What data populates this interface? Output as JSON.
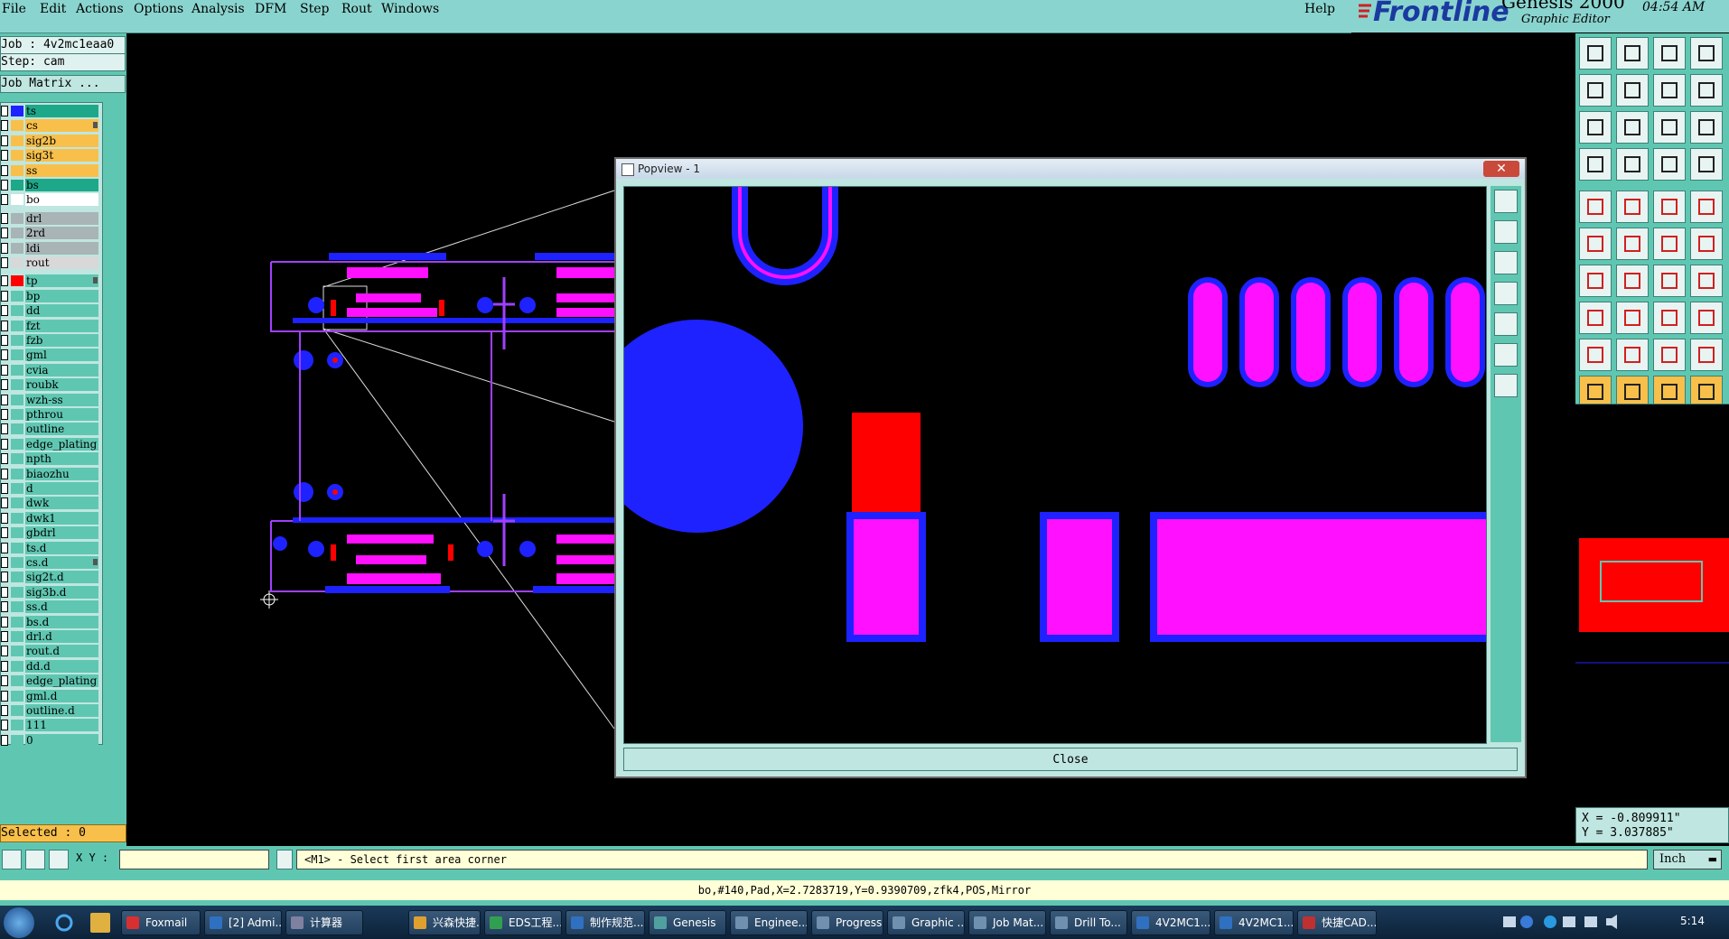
{
  "menu": {
    "items": [
      "File",
      "Edit",
      "Actions",
      "Options",
      "Analysis",
      "DFM",
      "Step",
      "Rout",
      "Windows"
    ],
    "help": "Help"
  },
  "brand": {
    "logo": "Frontline",
    "product": "Genesis 2000",
    "subtitle": "Graphic Editor",
    "clock": "04:54 AM"
  },
  "left": {
    "job": "Job : 4v2mc1eaa0",
    "step": "Step: cam",
    "job_matrix": "Job Matrix ...",
    "selected": "Selected : 0",
    "layers": [
      {
        "name": "ts",
        "color": "#1ea88a",
        "swatch": "#1e22ff"
      },
      {
        "name": "cs",
        "color": "#f8c04a",
        "swatch": "#f8c04a",
        "flag": true
      },
      {
        "name": "sig2b",
        "color": "#f8c04a",
        "swatch": "#f8c04a"
      },
      {
        "name": "sig3t",
        "color": "#f8c04a",
        "swatch": "#f8c04a"
      },
      {
        "name": "ss",
        "color": "#f8c04a",
        "swatch": "#f8c04a"
      },
      {
        "name": "bs",
        "color": "#1ea88a",
        "swatch": "#1ea88a"
      },
      {
        "name": "bo",
        "color": "#ffffff",
        "swatch": "#ffffff"
      },
      {
        "name": "drl",
        "color": "#a8b4b6",
        "swatch": "#a8b4b6",
        "gap": true
      },
      {
        "name": "2rd",
        "color": "#a8b4b6",
        "swatch": "#a8b4b6"
      },
      {
        "name": "ldi",
        "color": "#a8b4b6",
        "swatch": "#a8b4b6"
      },
      {
        "name": "rout",
        "color": "#d8d8d8",
        "swatch": "#d8d8d8"
      },
      {
        "name": "tp",
        "color": "#5fc7b1",
        "swatch": "#ff0000",
        "gap": true,
        "flag": true
      },
      {
        "name": "bp",
        "color": "#5fc7b1",
        "swatch": "#5fc7b1"
      },
      {
        "name": "dd",
        "color": "#5fc7b1",
        "swatch": "#5fc7b1"
      },
      {
        "name": "fzt",
        "color": "#5fc7b1",
        "swatch": "#5fc7b1"
      },
      {
        "name": "fzb",
        "color": "#5fc7b1",
        "swatch": "#5fc7b1"
      },
      {
        "name": "gml",
        "color": "#5fc7b1",
        "swatch": "#5fc7b1"
      },
      {
        "name": "cvia",
        "color": "#5fc7b1",
        "swatch": "#5fc7b1"
      },
      {
        "name": "roubk",
        "color": "#5fc7b1",
        "swatch": "#5fc7b1"
      },
      {
        "name": "wzh-ss",
        "color": "#5fc7b1",
        "swatch": "#5fc7b1"
      },
      {
        "name": "pthrou",
        "color": "#5fc7b1",
        "swatch": "#5fc7b1"
      },
      {
        "name": "outline",
        "color": "#5fc7b1",
        "swatch": "#5fc7b1"
      },
      {
        "name": "edge_plating",
        "color": "#5fc7b1",
        "swatch": "#5fc7b1"
      },
      {
        "name": "npth",
        "color": "#5fc7b1",
        "swatch": "#5fc7b1"
      },
      {
        "name": "biaozhu",
        "color": "#5fc7b1",
        "swatch": "#5fc7b1"
      },
      {
        "name": "d",
        "color": "#5fc7b1",
        "swatch": "#5fc7b1"
      },
      {
        "name": "dwk",
        "color": "#5fc7b1",
        "swatch": "#5fc7b1"
      },
      {
        "name": "dwk1",
        "color": "#5fc7b1",
        "swatch": "#5fc7b1"
      },
      {
        "name": "gbdrl",
        "color": "#5fc7b1",
        "swatch": "#5fc7b1"
      },
      {
        "name": "ts.d",
        "color": "#5fc7b1",
        "swatch": "#5fc7b1"
      },
      {
        "name": "cs.d",
        "color": "#5fc7b1",
        "swatch": "#5fc7b1",
        "flag": true
      },
      {
        "name": "sig2t.d",
        "color": "#5fc7b1",
        "swatch": "#5fc7b1"
      },
      {
        "name": "sig3b.d",
        "color": "#5fc7b1",
        "swatch": "#5fc7b1"
      },
      {
        "name": "ss.d",
        "color": "#5fc7b1",
        "swatch": "#5fc7b1"
      },
      {
        "name": "bs.d",
        "color": "#5fc7b1",
        "swatch": "#5fc7b1"
      },
      {
        "name": "drl.d",
        "color": "#5fc7b1",
        "swatch": "#5fc7b1"
      },
      {
        "name": "rout.d",
        "color": "#5fc7b1",
        "swatch": "#5fc7b1"
      },
      {
        "name": "dd.d",
        "color": "#5fc7b1",
        "swatch": "#5fc7b1"
      },
      {
        "name": "edge_plating",
        "color": "#5fc7b1",
        "swatch": "#5fc7b1"
      },
      {
        "name": "gml.d",
        "color": "#5fc7b1",
        "swatch": "#5fc7b1"
      },
      {
        "name": "outline.d",
        "color": "#5fc7b1",
        "swatch": "#5fc7b1"
      },
      {
        "name": "111",
        "color": "#5fc7b1",
        "swatch": "#5fc7b1"
      },
      {
        "name": "0",
        "color": "#5fc7b1",
        "swatch": "#5fc7b1"
      }
    ]
  },
  "popview": {
    "title": "Popview - 1",
    "close_label": "Close",
    "close_x": "✕"
  },
  "coords": {
    "x": "X = -0.809911\"",
    "y": "Y = 3.037885\""
  },
  "cmd": {
    "xy_label": "X Y :",
    "xy_value": "",
    "prompt": "<M1> - Select first area corner",
    "units": "Inch"
  },
  "status": "bo,#140,Pad,X=2.7283719,Y=0.9390709,zfk4,POS,Mirror",
  "taskbar": {
    "items": [
      {
        "label": "Foxmail",
        "icon": "#d83030"
      },
      {
        "label": "[2] Admi...",
        "icon": "#3070c0"
      },
      {
        "label": "计算器",
        "icon": "#8080a0"
      },
      {
        "label": "兴森快捷...",
        "icon": "#e0a030"
      },
      {
        "label": "EDS工程...",
        "icon": "#30a050"
      },
      {
        "label": "制作规范...",
        "icon": "#3070c0"
      },
      {
        "label": "Genesis",
        "icon": "#50a0a0"
      },
      {
        "label": "Enginee...",
        "icon": "#7090b0"
      },
      {
        "label": "Progress",
        "icon": "#7090b0"
      },
      {
        "label": "Graphic ...",
        "icon": "#7090b0"
      },
      {
        "label": "Job Mat...",
        "icon": "#7090b0"
      },
      {
        "label": "Drill To...",
        "icon": "#7090b0"
      },
      {
        "label": "4V2MC1...",
        "icon": "#3070c0"
      },
      {
        "label": "4V2MC1...",
        "icon": "#3070c0"
      },
      {
        "label": "快捷CAD...",
        "icon": "#c03030"
      }
    ],
    "time": "5:14"
  },
  "colors": {
    "panel": "#5fc7b1",
    "panel_light": "#bfe6e0",
    "pad_magenta": "#ff10ff",
    "pad_blue": "#1e22ff",
    "pad_red": "#ff0000",
    "highlight": "#f8c04a"
  }
}
